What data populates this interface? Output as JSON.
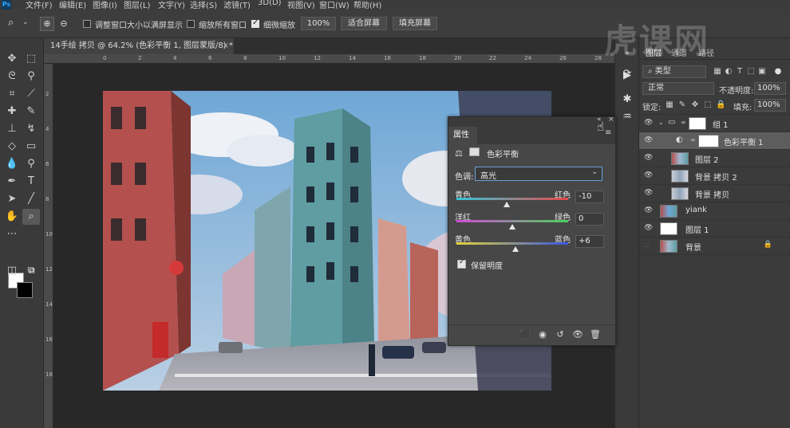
{
  "menubar": {
    "logo": "Ps",
    "items": [
      "文件(F)",
      "编辑(E)",
      "图像(I)",
      "图层(L)",
      "文字(Y)",
      "选择(S)",
      "滤镜(T)",
      "3D(D)",
      "视图(V)",
      "窗口(W)",
      "帮助(H)"
    ]
  },
  "options": {
    "zoom_tool": "🔍",
    "resize_windows_label": "调整窗口大小以满屏显示",
    "zoom_all_label": "缩放所有窗口",
    "scrubby_label": "细微缩放",
    "zoom_value": "100%",
    "fit_screen": "适合屏幕",
    "fill_screen": "填充屏幕"
  },
  "document": {
    "tab_title": "14手绘 拷贝 @ 64.2% (色彩平衡 1, 图层蒙版/8) *",
    "close": "×"
  },
  "rulers": {
    "top": [
      "0",
      "2",
      "4",
      "6",
      "8",
      "10",
      "12",
      "14",
      "16",
      "18",
      "20",
      "22",
      "24",
      "26",
      "28",
      "30"
    ],
    "left": [
      "2",
      "4",
      "6",
      "8",
      "10",
      "12",
      "14",
      "16",
      "18"
    ]
  },
  "layers_panel": {
    "tabs": [
      "图层",
      "通道",
      "路径"
    ],
    "filter_kind": "类型",
    "blend_mode": "正常",
    "opacity_label": "不透明度:",
    "opacity_value": "100%",
    "lock_label": "锁定:",
    "fill_label": "填充:",
    "fill_value": "100%",
    "layers": [
      {
        "name": "组 1",
        "kind": "group",
        "visible": true,
        "selected": false
      },
      {
        "name": "色彩平衡 1",
        "kind": "adjustment",
        "visible": true,
        "selected": true
      },
      {
        "name": "图层 2",
        "kind": "image",
        "visible": true,
        "selected": false
      },
      {
        "name": "背景 拷贝 2",
        "kind": "image",
        "visible": true,
        "selected": false
      },
      {
        "name": "背景 拷贝",
        "kind": "image",
        "visible": true,
        "selected": false
      },
      {
        "name": "yiank",
        "kind": "image",
        "visible": true,
        "selected": false
      },
      {
        "name": "图层 1",
        "kind": "white",
        "visible": true,
        "selected": false
      },
      {
        "name": "背景",
        "kind": "image",
        "visible": false,
        "selected": false
      }
    ]
  },
  "properties": {
    "tab": "属性",
    "title": "色彩平衡",
    "tone_label": "色调:",
    "tone_value": "高光",
    "sliders": [
      {
        "left": "青色",
        "right": "红色",
        "value": "-10",
        "level": -10
      },
      {
        "left": "洋红",
        "right": "绿色",
        "value": "0",
        "level": 0
      },
      {
        "left": "黄色",
        "right": "蓝色",
        "value": "+6",
        "level": 6
      }
    ],
    "preserve_label": "保留明度",
    "preserve_checked": true
  },
  "watermark": "虎课网"
}
